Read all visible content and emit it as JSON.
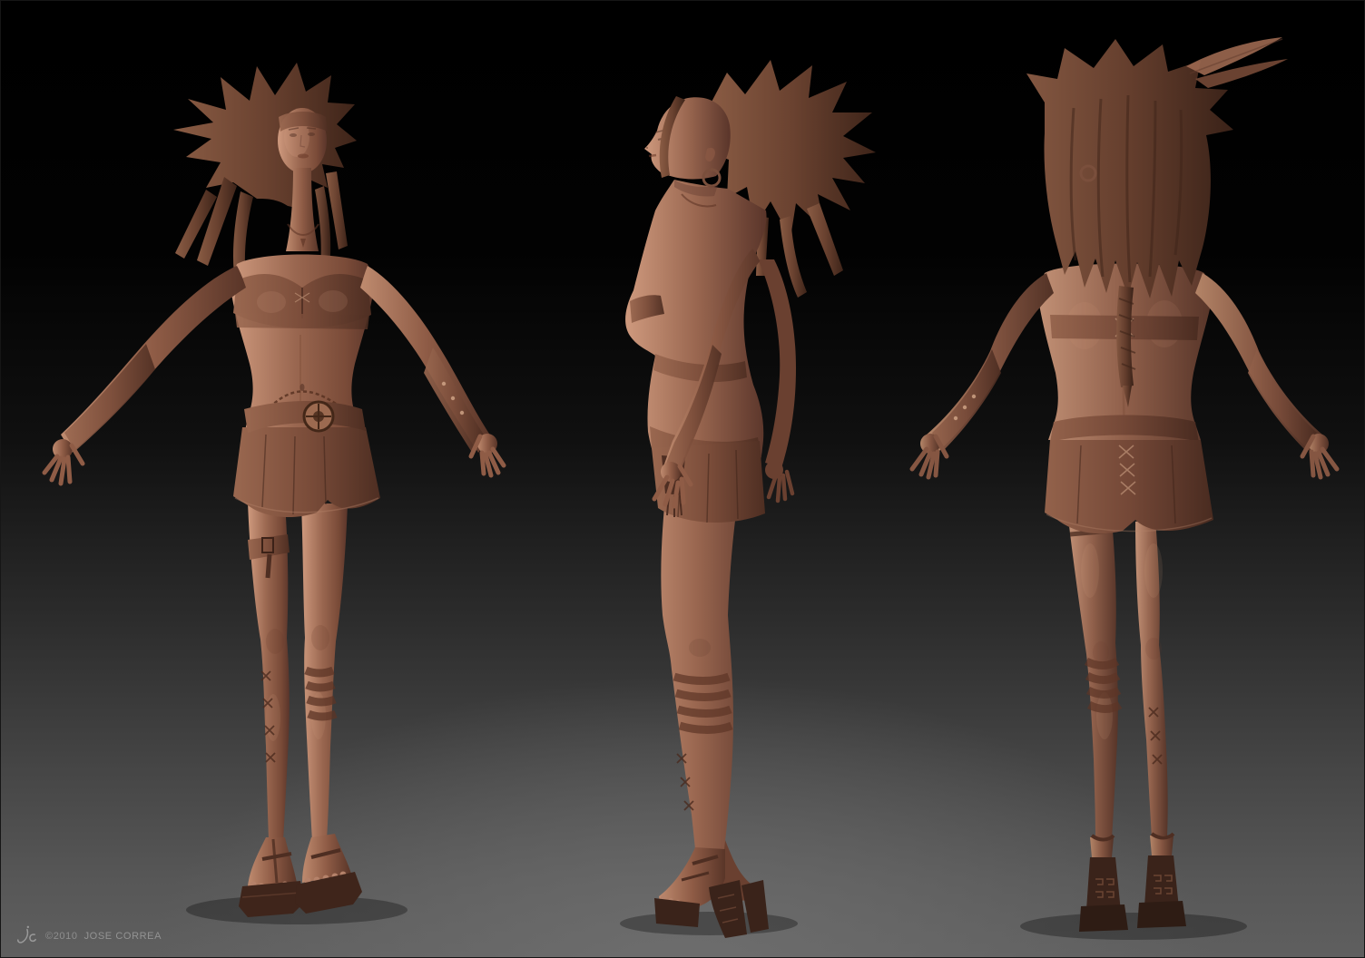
{
  "scene": {
    "description": "3D clay sculpt of a female character shown in a three-view turnaround",
    "background_top_color": "#000000",
    "background_bottom_color": "#616161",
    "clay_highlight": "#cf9a7e",
    "clay_base": "#9a6750",
    "clay_shadow": "#563428"
  },
  "views": [
    {
      "label": "character sculpt front view"
    },
    {
      "label": "character sculpt side profile view"
    },
    {
      "label": "character sculpt back view"
    }
  ],
  "footer": {
    "year_mark": "©2010",
    "artist_name": "JOSE CORREA",
    "signature": "jc"
  }
}
